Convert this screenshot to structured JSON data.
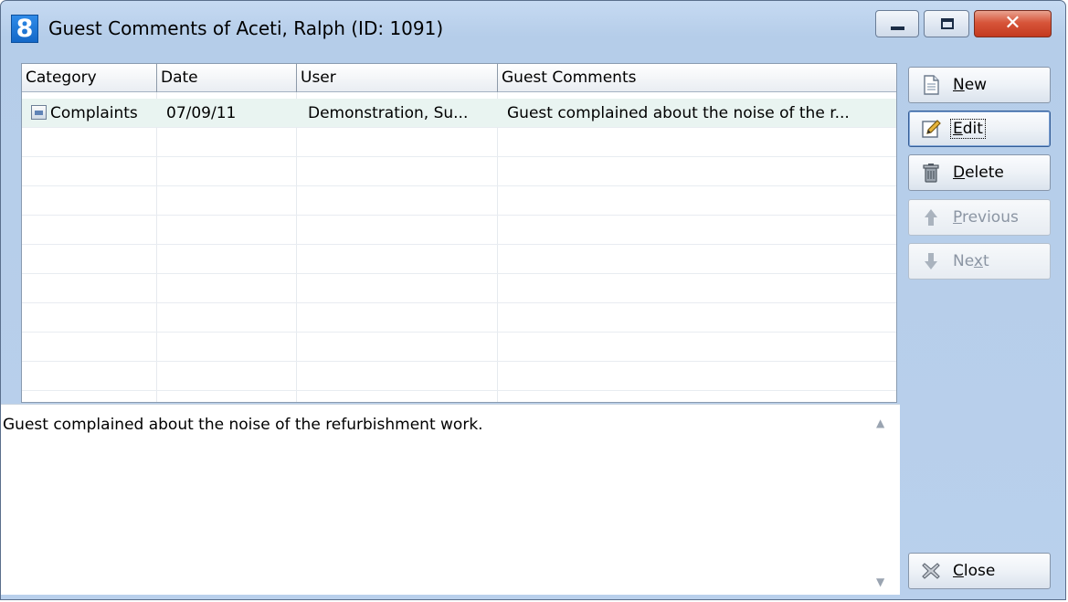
{
  "window": {
    "app_icon_glyph": "8",
    "title": "Guest Comments of Aceti, Ralph (ID: 1091)",
    "controls": {
      "minimize_icon": "minimize-icon",
      "maximize_icon": "maximize-icon",
      "close_glyph": "✕"
    }
  },
  "grid": {
    "columns": [
      "Category",
      "Date",
      "User",
      "Guest Comments"
    ],
    "rows": [
      {
        "category": "Complaints",
        "date": "07/09/11",
        "user": "Demonstration, Su...",
        "comment": "Guest complained about the noise of the r..."
      }
    ]
  },
  "detail": {
    "text": "Guest complained about the noise of the refurbishment work."
  },
  "buttons": {
    "new": {
      "pre": "",
      "key": "N",
      "post": "ew",
      "icon": "new-document-icon"
    },
    "edit": {
      "pre": "",
      "key": "E",
      "post": "dit",
      "icon": "edit-pencil-icon"
    },
    "delete": {
      "pre": "",
      "key": "D",
      "post": "elete",
      "icon": "trash-icon"
    },
    "previous": {
      "pre": "",
      "key": "P",
      "post": "revious",
      "icon": "arrow-up-icon"
    },
    "next": {
      "pre": "Ne",
      "key": "x",
      "post": "t",
      "icon": "arrow-down-icon"
    },
    "close": {
      "pre": "",
      "key": "C",
      "post": "lose",
      "icon": "close-x-icon"
    }
  },
  "colors": {
    "selection": "#e9f4f1",
    "frame": "#b9d0ec",
    "close_button": "#c43a1f"
  }
}
